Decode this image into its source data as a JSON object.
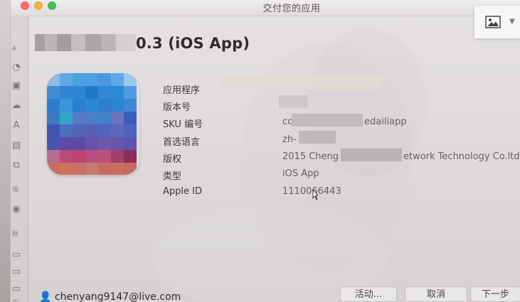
{
  "window": {
    "title": "交付您的应用"
  },
  "app": {
    "title_suffix": "0.3 (iOS App)"
  },
  "sidebar": {
    "texts": [
      "A",
      "设",
      "标",
      "应"
    ]
  },
  "details": [
    {
      "label": "应用程序",
      "value": ""
    },
    {
      "label": "版本号",
      "value": ""
    },
    {
      "label": "SKU 编号",
      "value": "co",
      "suffix": "edailiapp"
    },
    {
      "label": "首选语言",
      "value": "zh-"
    },
    {
      "label": "版权",
      "value": "2015 Cheng",
      "suffix": "etwork Technology Co.ltd"
    },
    {
      "label": "类型",
      "value": "iOS App"
    },
    {
      "label": "Apple ID",
      "value": "1110066443"
    }
  ],
  "footer": {
    "account": "chenyang9147@live.com",
    "activity_label": "活动...",
    "cancel_label": "取消",
    "next_label": "下一步"
  },
  "toolbar": {
    "image_icon": "image-icon",
    "dropdown_icon": "chevron-down-icon"
  },
  "colors": {
    "traffic_red": "#ff5f57",
    "traffic_yellow": "#febc2e",
    "traffic_green": "#28c840",
    "icon_blue": "#3f88d8",
    "icon_purple": "#8f4d7e",
    "icon_orange": "#c26a5d"
  }
}
